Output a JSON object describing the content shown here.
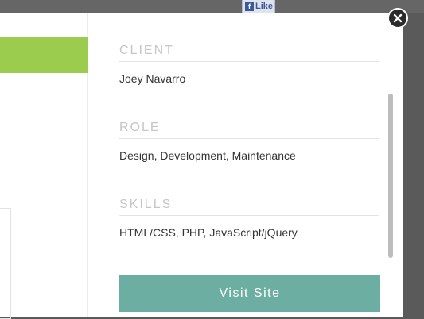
{
  "facebook": {
    "like_label": "Like",
    "icon": "facebook-icon"
  },
  "project": {
    "client": {
      "label": "CLIENT",
      "value": "Joey Navarro"
    },
    "role": {
      "label": "ROLE",
      "value": "Design, Development, Maintenance"
    },
    "skills": {
      "label": "SKILLS",
      "value": "HTML/CSS, PHP, JavaScript/jQuery"
    }
  },
  "visit_button_label": "Visit Site",
  "close_icon": "close-icon",
  "colors": {
    "accent_green": "#9ccc4e",
    "button_teal": "#6daea2",
    "overlay": "#5a5a5a"
  }
}
